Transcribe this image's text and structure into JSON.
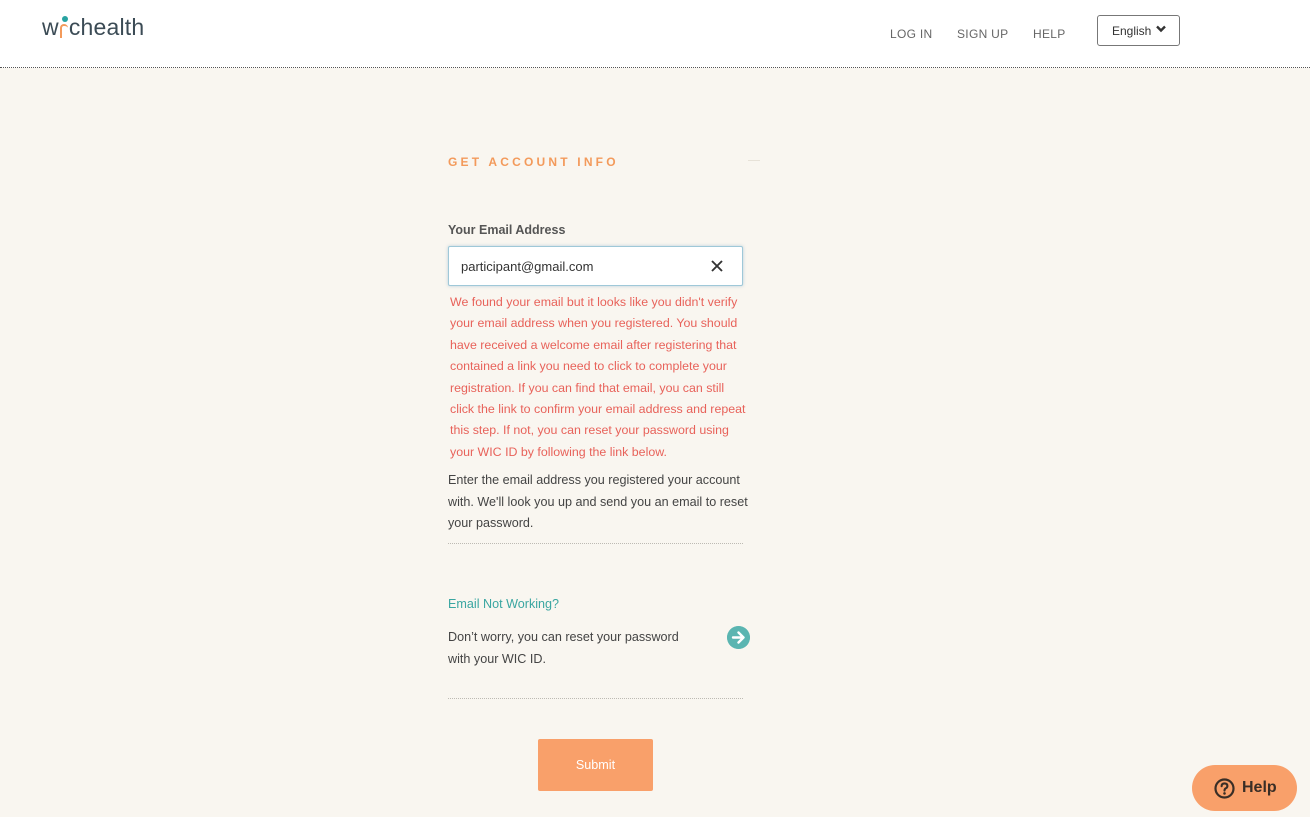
{
  "header": {
    "logo_prefix": "w",
    "logo_suffix": "chealth",
    "nav": {
      "login": "LOG IN",
      "signup": "SIGN UP",
      "help": "HELP"
    },
    "language": "English"
  },
  "form": {
    "section_title": "GET ACCOUNT INFO",
    "email_label": "Your Email Address",
    "email_value": "participant@gmail.com",
    "error_message": "We found your email but it looks like you didn't verify your email address when you registered. You should have received a welcome email after registering that contained a link you need to click to complete your registration. If you can find that email, you can still click the link to confirm your email address and repeat this step. If not, you can reset your password using your WIC ID by following the link below.",
    "instructions": "Enter the email address you registered your account with. We'll look you up and send you an email to reset your password.",
    "email_not_working_title": "Email Not Working?",
    "email_not_working_text": "Don’t worry, you can reset your password with your WIC ID.",
    "submit_label": "Submit"
  },
  "help_fab": {
    "label": "Help"
  },
  "colors": {
    "accent_orange": "#f9a06a",
    "teal": "#3aa6a1",
    "error_red": "#e8625a",
    "background": "#f9f6f0"
  },
  "icons": {
    "clear": "close-icon",
    "arrow": "arrow-right-circle-icon",
    "chevron": "chevron-down-icon",
    "help": "question-circle-icon"
  }
}
